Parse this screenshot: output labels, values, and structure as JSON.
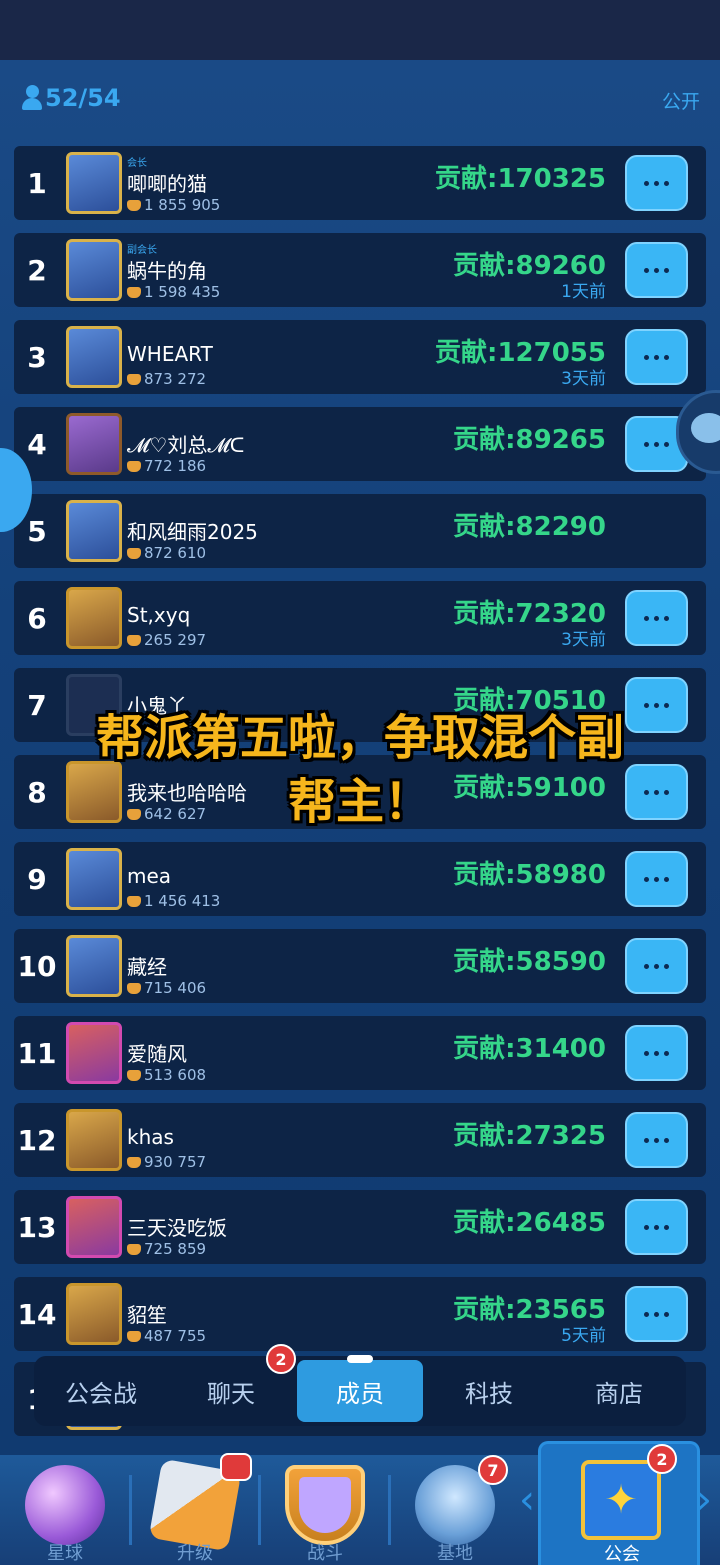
{
  "header": {
    "member_count": "52/54",
    "visibility": "公开"
  },
  "members": [
    {
      "rank": "1",
      "role": "会长",
      "name": "唧唧的猫",
      "trophies": "1 855 905",
      "contribution": "贡献:170325",
      "last_seen": "",
      "avatar": "blue"
    },
    {
      "rank": "2",
      "role": "副会长",
      "name": "蜗牛的角",
      "trophies": "1 598 435",
      "contribution": "贡献:89260",
      "last_seen": "1天前",
      "avatar": "blue"
    },
    {
      "rank": "3",
      "role": "",
      "name": "WHEART",
      "trophies": "873 272",
      "contribution": "贡献:127055",
      "last_seen": "3天前",
      "avatar": "blue"
    },
    {
      "rank": "4",
      "role": "",
      "name": "𝓜♡刘总𝓜ᑕ",
      "trophies": "772 186",
      "contribution": "贡献:89265",
      "last_seen": "",
      "avatar": "purple"
    },
    {
      "rank": "5",
      "role": "",
      "name": "和风细雨2025",
      "trophies": "872 610",
      "contribution": "贡献:82290",
      "last_seen": "",
      "avatar": "blue"
    },
    {
      "rank": "6",
      "role": "",
      "name": "St,xyq",
      "trophies": "265 297",
      "contribution": "贡献:72320",
      "last_seen": "3天前",
      "avatar": "gold"
    },
    {
      "rank": "7",
      "role": "",
      "name": "小鬼丫",
      "trophies": "",
      "contribution": "贡献:70510",
      "last_seen": "",
      "avatar": "dark"
    },
    {
      "rank": "8",
      "role": "",
      "name": "我来也哈哈哈",
      "trophies": "642 627",
      "contribution": "贡献:59100",
      "last_seen": "",
      "avatar": "gold"
    },
    {
      "rank": "9",
      "role": "",
      "name": "mea",
      "trophies": "1 456 413",
      "contribution": "贡献:58980",
      "last_seen": "",
      "avatar": "blue"
    },
    {
      "rank": "10",
      "role": "",
      "name": "藏经",
      "trophies": "715 406",
      "contribution": "贡献:58590",
      "last_seen": "",
      "avatar": "blue"
    },
    {
      "rank": "11",
      "role": "",
      "name": "爱随风",
      "trophies": "513 608",
      "contribution": "贡献:31400",
      "last_seen": "",
      "avatar": "pink"
    },
    {
      "rank": "12",
      "role": "",
      "name": "khas",
      "trophies": "930 757",
      "contribution": "贡献:27325",
      "last_seen": "",
      "avatar": "gold"
    },
    {
      "rank": "13",
      "role": "",
      "name": "三天没吃饭",
      "trophies": "725 859",
      "contribution": "贡献:26485",
      "last_seen": "",
      "avatar": "pink"
    },
    {
      "rank": "14",
      "role": "",
      "name": "貂笙",
      "trophies": "487 755",
      "contribution": "贡献:23565",
      "last_seen": "5天前",
      "avatar": "gold"
    },
    {
      "rank": "1",
      "role": "",
      "name": "",
      "trophies": "",
      "contribution": "",
      "last_seen": "",
      "avatar": "blue"
    }
  ],
  "overlay": {
    "line1": "帮派第五啦，争取混个副",
    "line2": "帮主！"
  },
  "tabs": {
    "guild_war": "公会战",
    "chat": "聊天",
    "chat_badge": "2",
    "members": "成员",
    "tech": "科技",
    "shop": "商店"
  },
  "nav": {
    "planet": "星球",
    "upgrade": "升级",
    "battle": "战斗",
    "base": "基地",
    "base_badge": "7",
    "guild": "公会",
    "guild_badge": "2"
  },
  "colors": {
    "contribution": "#35d68a",
    "accent": "#3aa8f0",
    "overlay_text": "#f6b61c",
    "badge": "#e03a3a"
  }
}
